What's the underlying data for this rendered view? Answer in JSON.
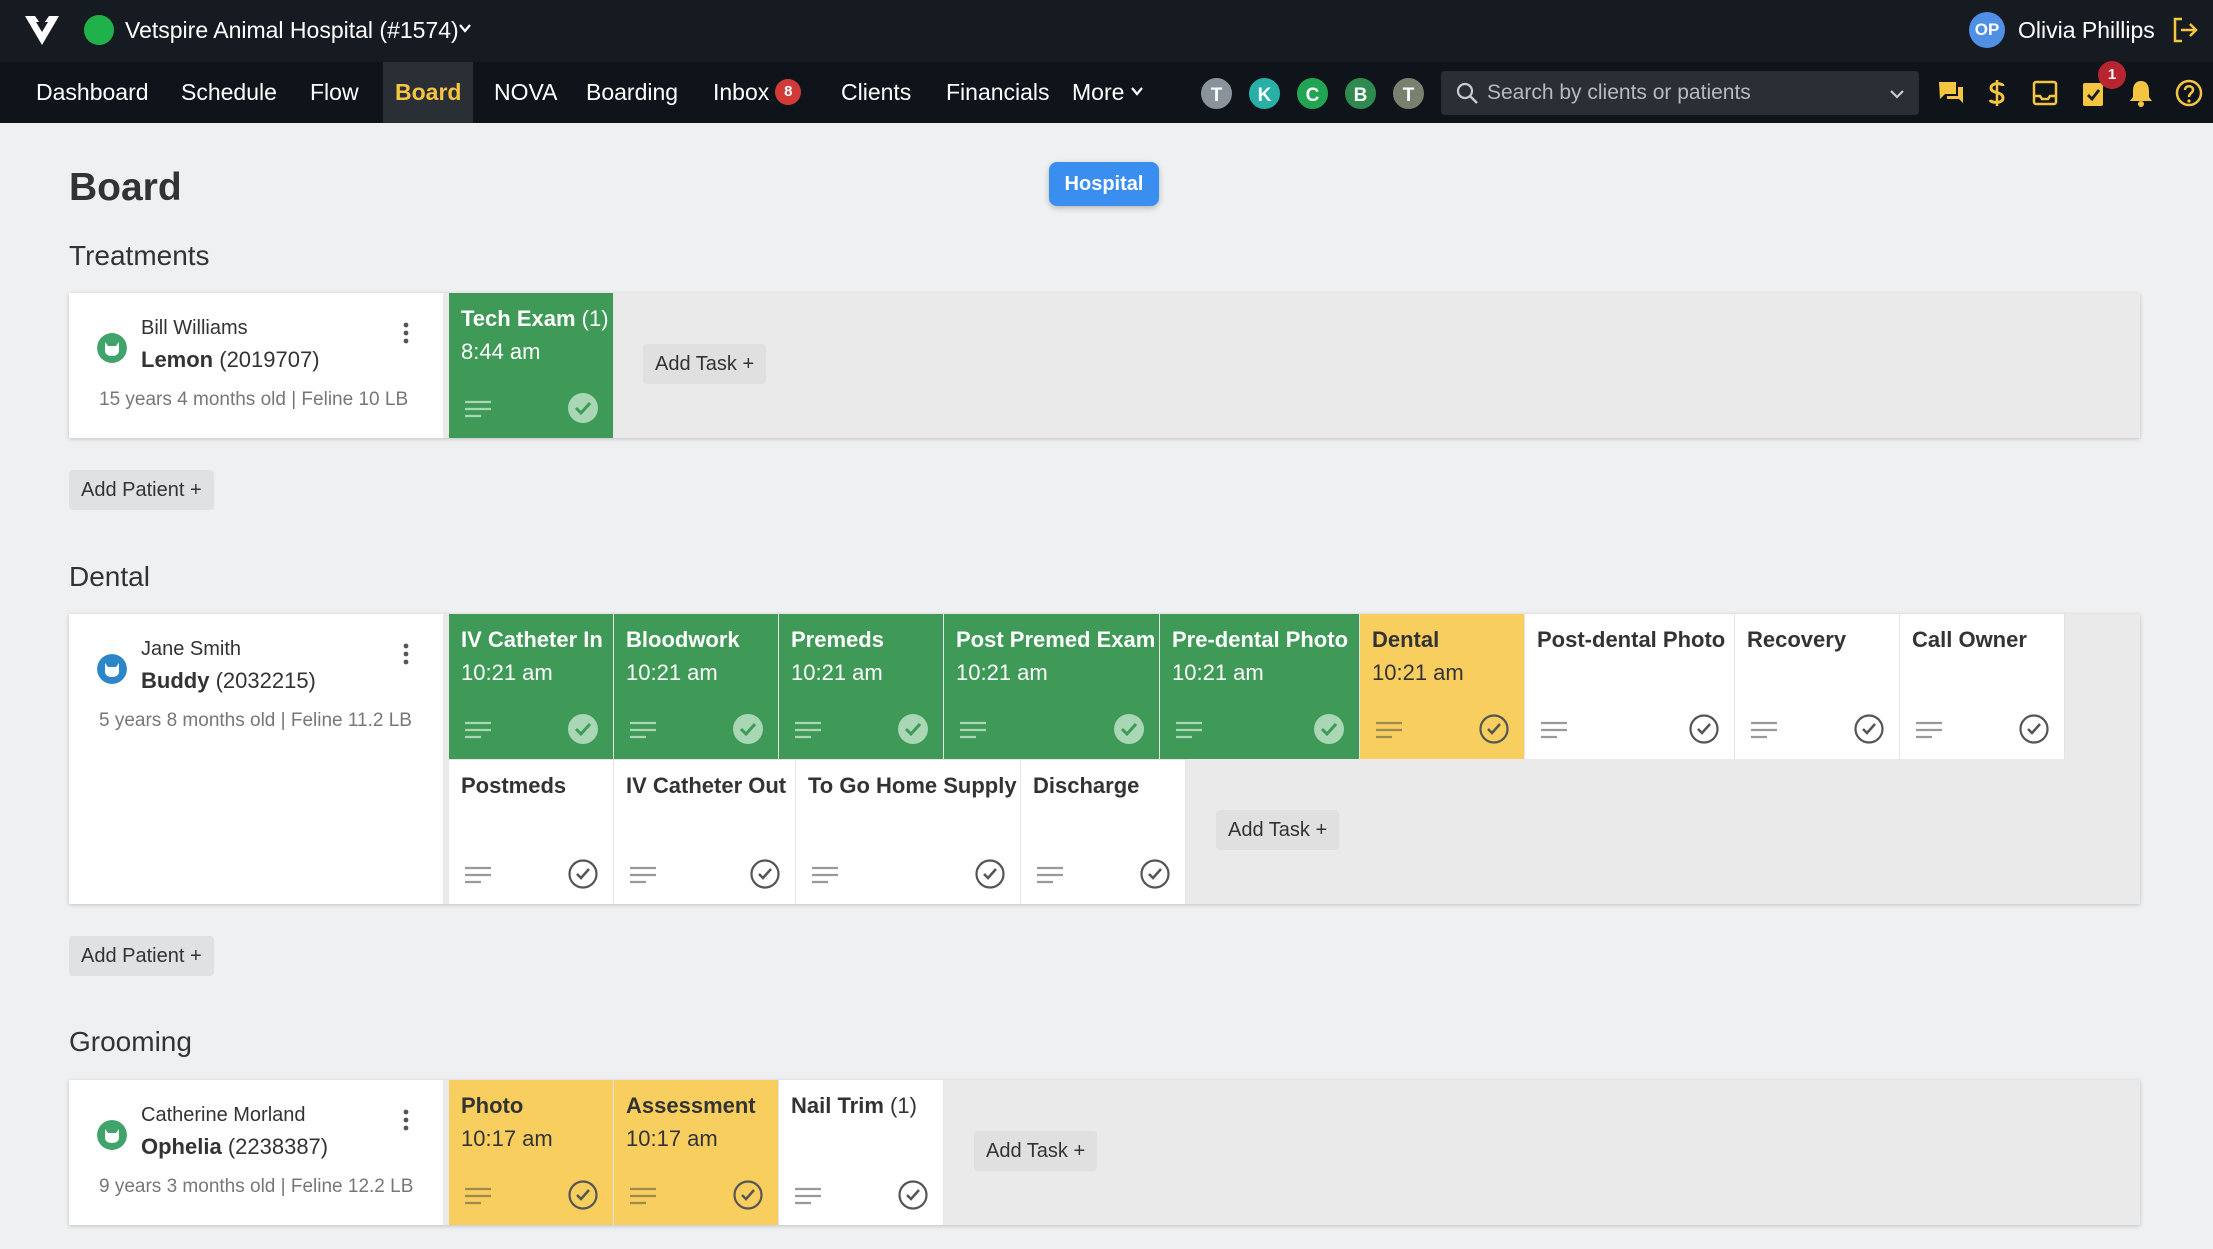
{
  "header": {
    "hospital_name": "Vetspire Animal Hospital (#1574)",
    "user_initials": "OP",
    "user_name": "Olivia Phillips"
  },
  "nav": {
    "items": [
      "Dashboard",
      "Schedule",
      "Flow",
      "Board",
      "NOVA",
      "Boarding",
      "Inbox",
      "Clients",
      "Financials",
      "More"
    ],
    "active": "Board",
    "inbox_count": "8",
    "tasks_count": "1"
  },
  "staff": [
    {
      "initial": "T",
      "color": "#8a939c"
    },
    {
      "initial": "K",
      "color": "#28b0a6"
    },
    {
      "initial": "C",
      "color": "#21a552"
    },
    {
      "initial": "B",
      "color": "#2e8a4e"
    },
    {
      "initial": "T",
      "color": "#7a8070"
    }
  ],
  "search": {
    "placeholder": "Search by clients or patients"
  },
  "page": {
    "title": "Board",
    "location_pill": "Hospital"
  },
  "sections": [
    {
      "title": "Treatments",
      "add_patient_label": "Add Patient +",
      "patient": {
        "owner": "Bill Williams",
        "pet_name": "Lemon",
        "pet_id": "(2019707)",
        "details": "15 years 4 months old | Feline  10 LB",
        "icon_color": "#3fa36a"
      },
      "tasks": [
        {
          "name": "Tech Exam",
          "count": "(1)",
          "time": "8:44 am",
          "status": "green"
        }
      ],
      "add_task_label": "Add Task +"
    },
    {
      "title": "Dental",
      "add_patient_label": "Add Patient +",
      "patient": {
        "owner": "Jane Smith",
        "pet_name": "Buddy",
        "pet_id": "(2032215)",
        "details": "5 years 8 months old | Feline 11.2 LB",
        "icon_color": "#2b87c9"
      },
      "tasks": [
        {
          "name": "IV Catheter In",
          "time": "10:21 am",
          "status": "green"
        },
        {
          "name": "Bloodwork",
          "time": "10:21 am",
          "status": "green"
        },
        {
          "name": "Premeds",
          "time": "10:21 am",
          "status": "green"
        },
        {
          "name": "Post Premed Exam",
          "time": "10:21 am",
          "status": "green"
        },
        {
          "name": "Pre-dental Photo",
          "time": "10:21 am",
          "status": "green"
        },
        {
          "name": "Dental",
          "time": "10:21 am",
          "status": "yellow"
        },
        {
          "name": "Post-dental Photo",
          "time": "",
          "status": "white"
        },
        {
          "name": "Recovery",
          "time": "",
          "status": "white"
        },
        {
          "name": "Call Owner",
          "time": "",
          "status": "white"
        },
        {
          "name": "Postmeds",
          "time": "",
          "status": "white"
        },
        {
          "name": "IV Catheter Out",
          "time": "",
          "status": "white"
        },
        {
          "name": "To Go Home Supply",
          "time": "",
          "status": "white"
        },
        {
          "name": "Discharge",
          "time": "",
          "status": "white"
        }
      ],
      "add_task_label": "Add Task +"
    },
    {
      "title": "Grooming",
      "patient": {
        "owner": "Catherine Morland",
        "pet_name": "Ophelia",
        "pet_id": "(2238387)",
        "details": "9 years 3 months old | Feline 12.2 LB",
        "icon_color": "#3fa36a"
      },
      "tasks": [
        {
          "name": "Photo",
          "time": "10:17 am",
          "status": "yellow"
        },
        {
          "name": "Assessment",
          "time": "10:17 am",
          "status": "yellow"
        },
        {
          "name": "Nail Trim",
          "count": "(1)",
          "time": "",
          "status": "white"
        }
      ],
      "add_task_label": "Add Task +"
    }
  ],
  "colors": {
    "green": "#3e9a56",
    "yellow": "#f8cf5f",
    "accent": "#3a8ef0",
    "badge": "#d23a3a"
  }
}
